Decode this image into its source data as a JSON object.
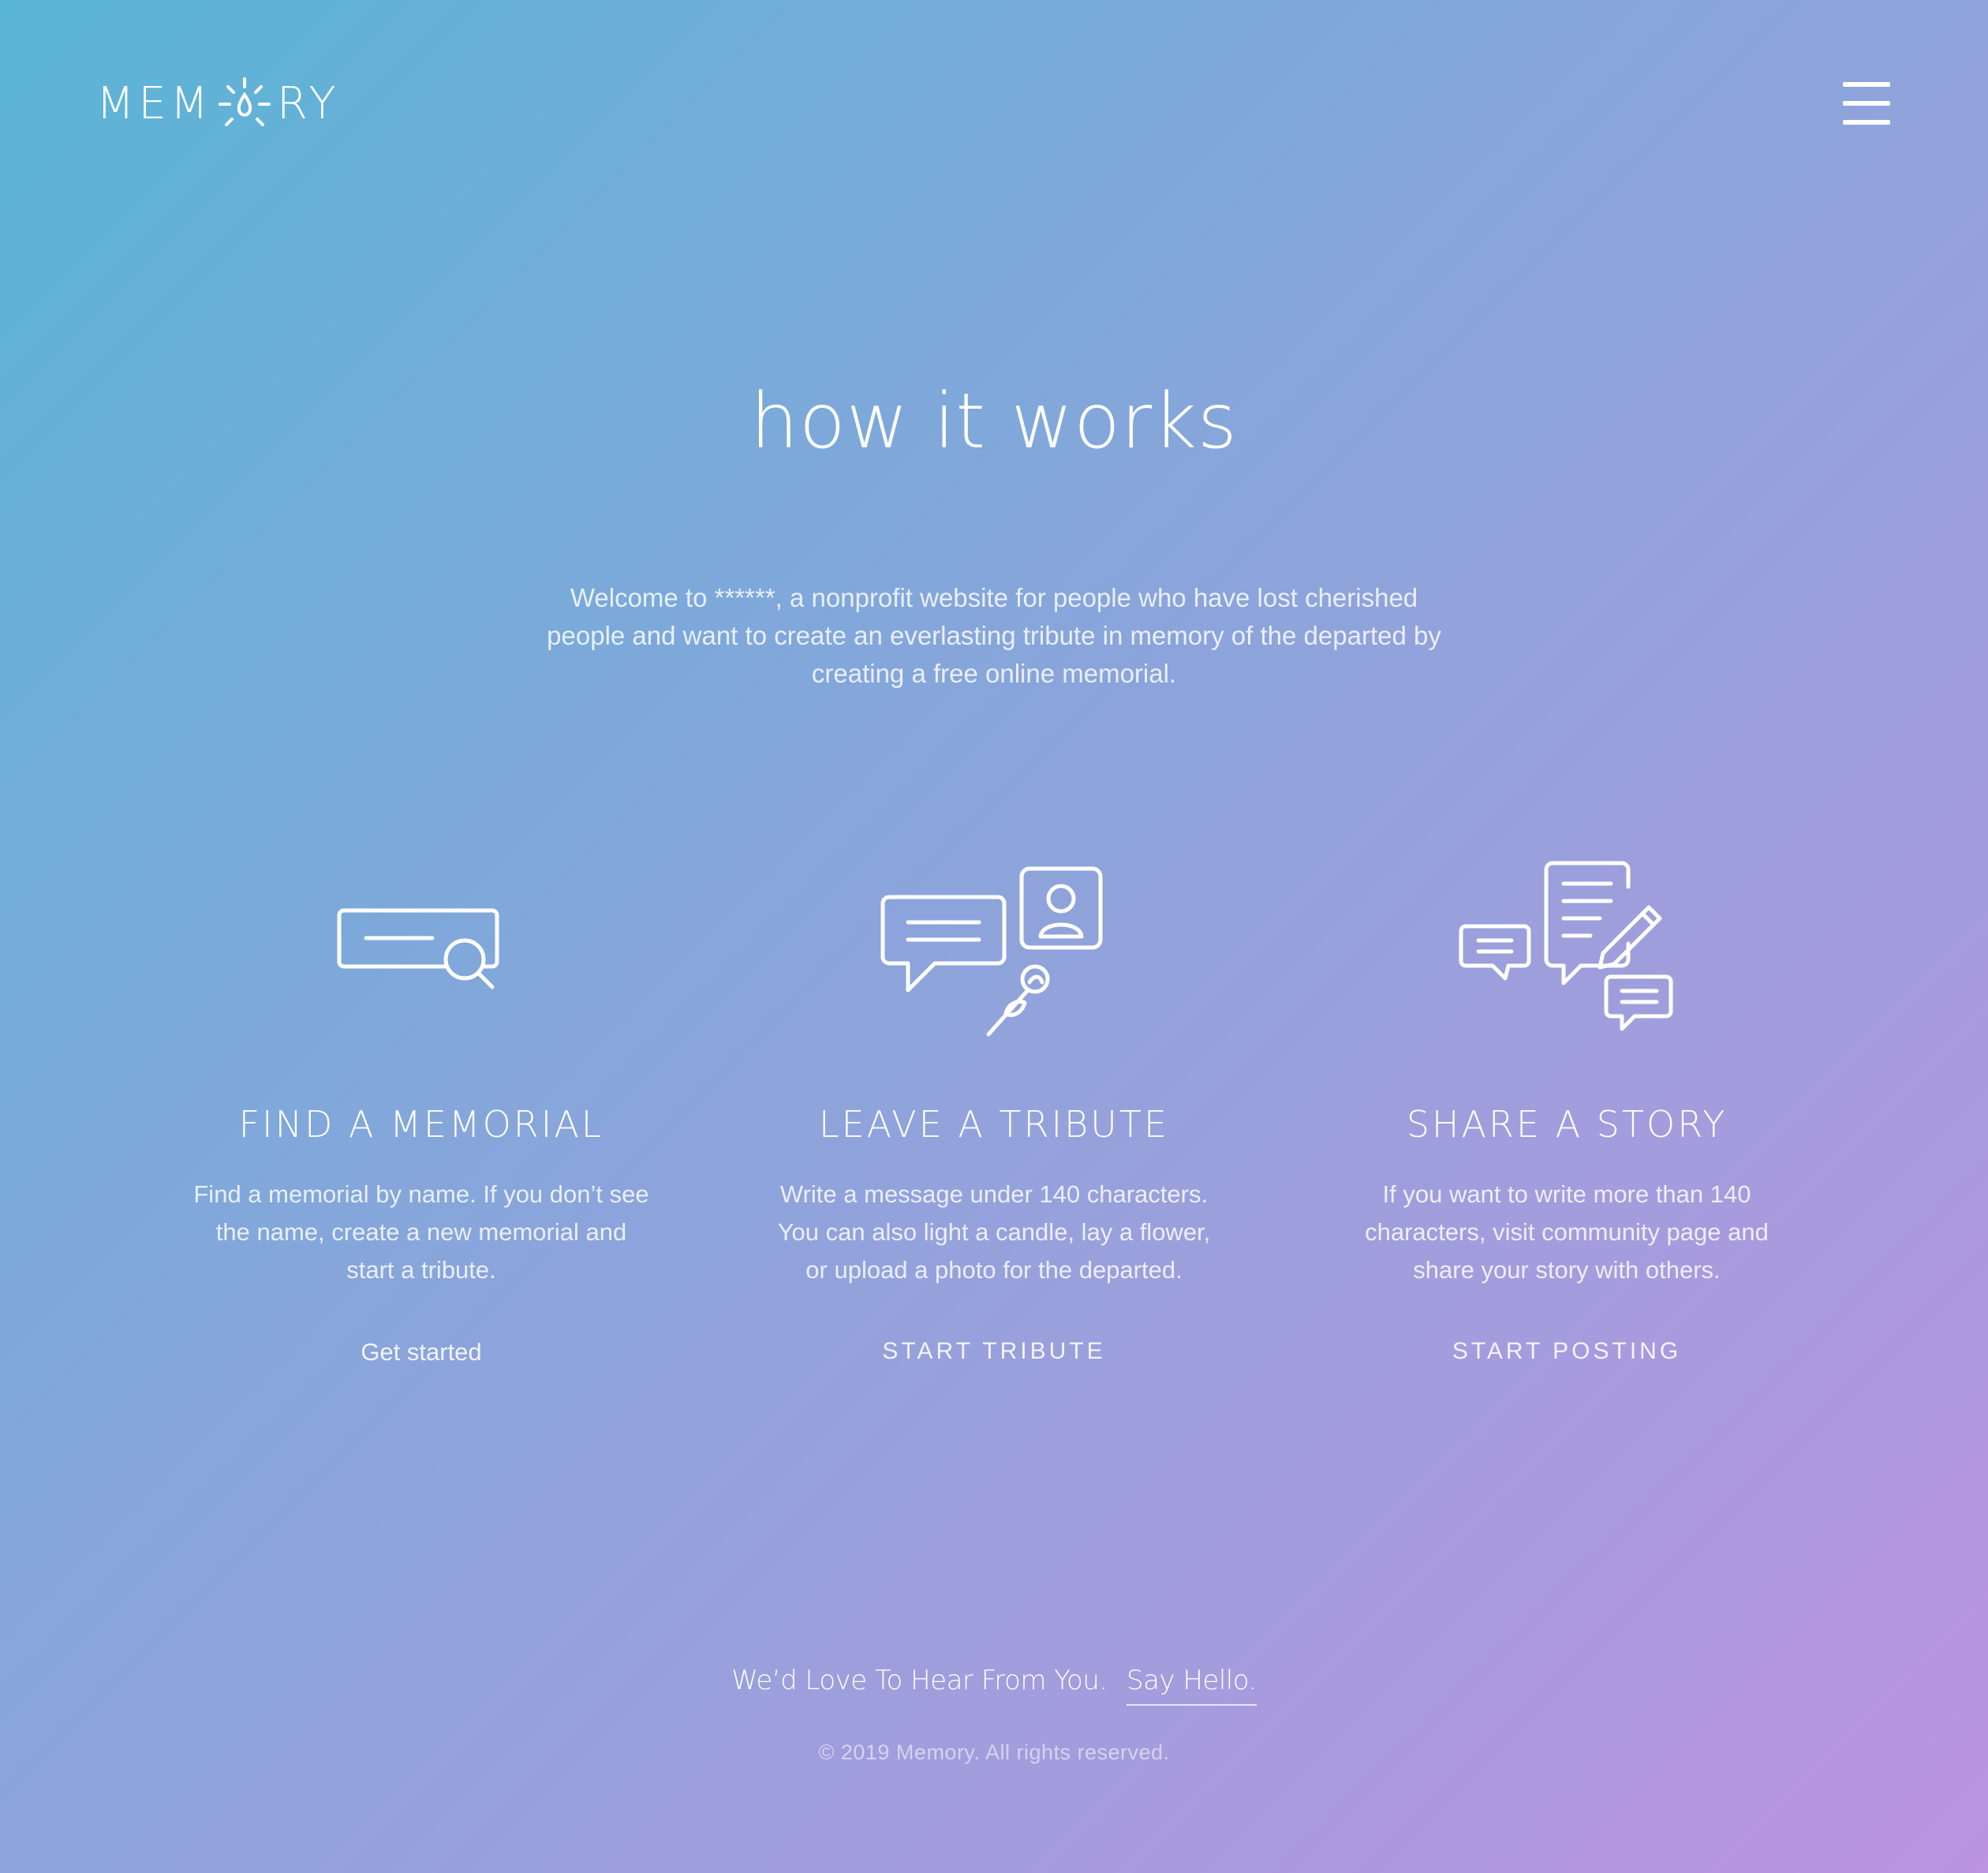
{
  "header": {
    "logo_left": "MEM",
    "logo_right": "RY",
    "logo_icon": "lightbulb-icon",
    "menu_icon": "hamburger-icon"
  },
  "main": {
    "title": "how it works",
    "intro": "Welcome to ******, a nonprofit website for people who have lost cherished people and want to create an everlasting tribute in memory of the departed by creating a free online memorial."
  },
  "features": [
    {
      "icon": "search-memorial-icon",
      "title": "FIND A MEMORIAL",
      "text": "Find a memorial by name. If you don’t see the name, create a new memorial and start a tribute.",
      "link": "Get started"
    },
    {
      "icon": "tribute-message-icon",
      "title": "LEAVE A TRIBUTE",
      "text": "Write a message under 140 characters. You can also light a candle, lay a flower, or upload a photo for the departed.",
      "link": "START TRIBUTE"
    },
    {
      "icon": "share-story-icon",
      "title": "SHARE A STORY",
      "text": "If you want to write more than 140 characters, visit community page and share your story with others.",
      "link": "START POSTING"
    }
  ],
  "footer": {
    "message": "We’d Love To Hear From You.",
    "say_hello": "Say Hello.",
    "copyright": "© 2019 Memory. All rights reserved."
  }
}
